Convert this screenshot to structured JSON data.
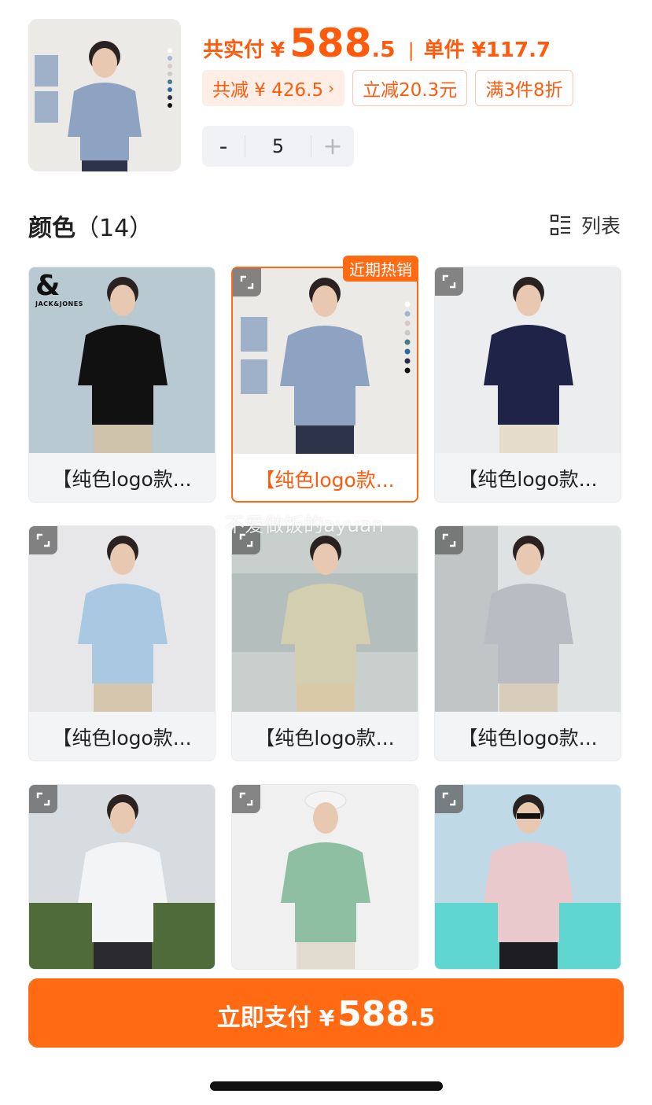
{
  "header": {
    "total_label": "共实付",
    "currency": "¥",
    "total_int": "588",
    "total_dec": ".5",
    "separator": "|",
    "unit_label": "单件 ¥117.7",
    "tags": [
      {
        "text": "共减 ¥ 426.5",
        "chevron": "›"
      },
      {
        "text": "立减20.3元"
      },
      {
        "text": "满3件8折"
      }
    ],
    "stepper": {
      "minus": "-",
      "value": "5",
      "plus": "+"
    }
  },
  "color_section": {
    "title": "颜色",
    "count": "（14）",
    "list_toggle_label": "列表",
    "list_toggle_icon": "list-view-icon"
  },
  "items": [
    {
      "label": "【纯色logo款...",
      "color": "#111111",
      "bg": "#b9c9d2",
      "brand": {
        "amp": "&",
        "text": "JACK&JONES"
      }
    },
    {
      "label": "【纯色logo款...",
      "color": "#8ea2c2",
      "bg": "#eceae6",
      "badge": "近期热销",
      "selected": true
    },
    {
      "label": "【纯色logo款...",
      "color": "#1f2347",
      "bg": "#ecedef"
    },
    {
      "label": "【纯色logo款...",
      "color": "#a9c8e2",
      "bg": "#e7e7ea"
    },
    {
      "label": "【纯色logo款...",
      "color": "#d4ceb1",
      "bg": "#c9cfcc"
    },
    {
      "label": "【纯色logo款...",
      "color": "#b9bcc2",
      "bg": "#dfe2e3"
    },
    {
      "label": "",
      "color": "#f3f4f6",
      "bg": "#d7dce0"
    },
    {
      "label": "",
      "color": "#8fbfa2",
      "bg": "#f0f0f0"
    },
    {
      "label": "",
      "color": "#e9c9cc",
      "bg": "#bfd9e6"
    }
  ],
  "watermark": "不爱做饭的ayuan",
  "pay_button": {
    "label": "立即支付",
    "currency": "¥",
    "int": "588",
    "dec": ".5"
  },
  "accent_color": "#ff6a12"
}
